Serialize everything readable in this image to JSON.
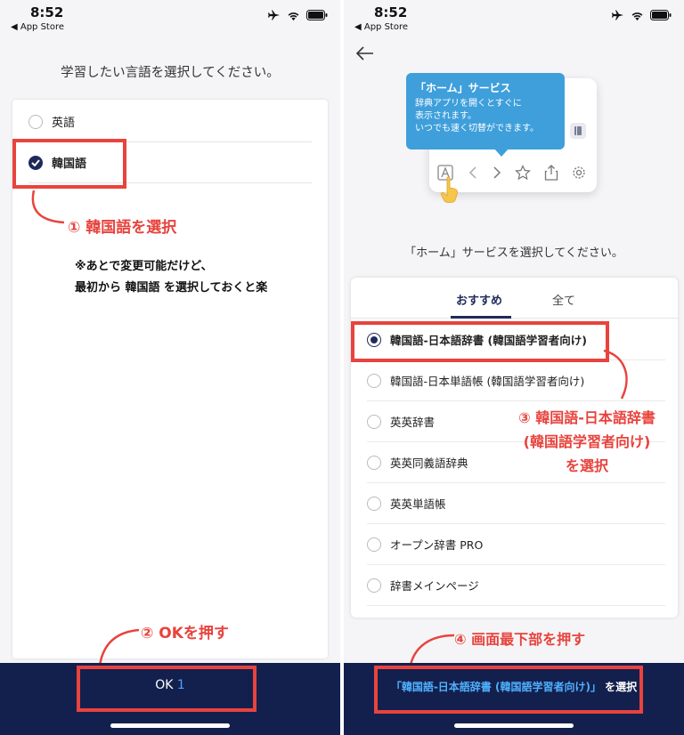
{
  "status_bar": {
    "time": "8:52",
    "back_app": "◀ App Store"
  },
  "left_screen": {
    "prompt": "学習したい言語を選択してください。",
    "languages": [
      {
        "label": "英語",
        "selected": false
      },
      {
        "label": "韓国語",
        "selected": true
      }
    ],
    "ok_button": {
      "label": "OK",
      "count": "1"
    }
  },
  "right_screen": {
    "tooltip": {
      "title": "「ホーム」サービス",
      "lines": [
        "辞典アプリを開くとすぐに",
        "表示されます。",
        "いつでも速く切替ができます。"
      ]
    },
    "prompt": "「ホーム」サービスを選択してください。",
    "tabs": [
      "おすすめ",
      "全て"
    ],
    "services": [
      {
        "label": "韓国語-日本語辞書 (韓国語学習者向け)",
        "selected": true
      },
      {
        "label": "韓国語-日本単語帳 (韓国語学習者向け)",
        "selected": false
      },
      {
        "label": "英英辞書",
        "selected": false
      },
      {
        "label": "英英同義語辞典",
        "selected": false
      },
      {
        "label": "英英単語帳",
        "selected": false
      },
      {
        "label": "オープン辞書 PRO",
        "selected": false
      },
      {
        "label": "辞書メインページ",
        "selected": false
      }
    ],
    "select_button": {
      "quoted": "「韓国語-日本語辞書 (韓国語学習者向け)」",
      "suffix": "を選択"
    }
  },
  "annotations": {
    "step1": "① 韓国語を選択",
    "note_line1": "※あとで変更可能だけど、",
    "note_line2": "最初から 韓国語 を選択しておくと楽",
    "step2": "② OKを押す",
    "step3_line1": "③ 韓国語-日本語辞書",
    "step3_line2": "(韓国語学習者向け)",
    "step3_line3": "を選択",
    "step4": "④ 画面最下部を押す"
  },
  "colors": {
    "accent_red": "#e8433d",
    "navy": "#13204d",
    "tooltip_blue": "#3e9fdb"
  }
}
